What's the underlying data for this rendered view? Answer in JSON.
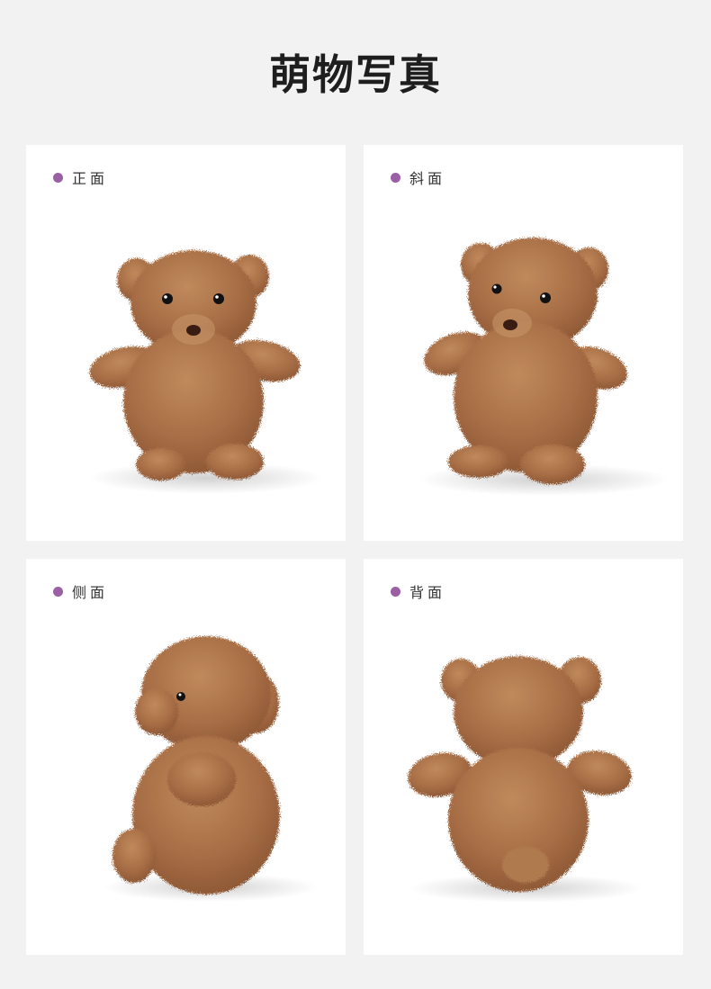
{
  "page": {
    "title": "萌物写真"
  },
  "views": [
    {
      "label": "正面"
    },
    {
      "label": "斜面"
    },
    {
      "label": "侧面"
    },
    {
      "label": "背面"
    }
  ],
  "colors": {
    "background": "#f2f2f2",
    "card": "#ffffff",
    "dot_accent": "#9b5fa6",
    "bear_fur": "#a76d45",
    "bear_fur_dark": "#8a5533",
    "bear_fur_light": "#c08a5c"
  }
}
